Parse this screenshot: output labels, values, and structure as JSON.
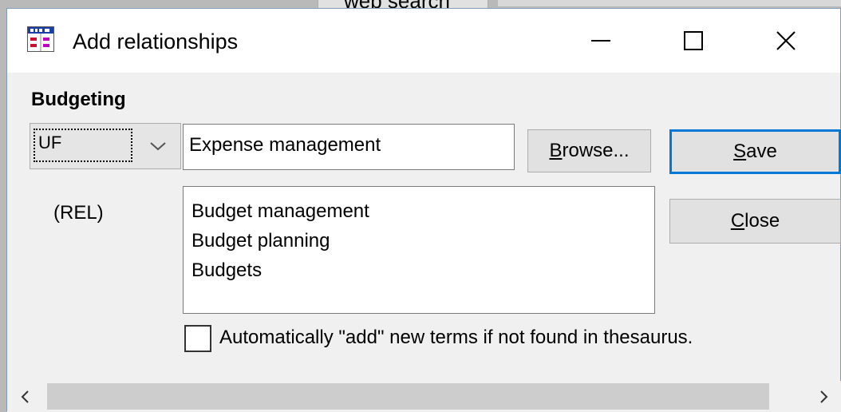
{
  "background": {
    "tab_label": "web search"
  },
  "window": {
    "title": "Add relationships",
    "icons": {
      "app": "thesaurus-app-icon",
      "minimize": "minimize-icon",
      "maximize": "maximize-icon",
      "close": "close-icon"
    }
  },
  "form": {
    "group_label": "Budgeting",
    "relationship_type": {
      "selected": "UF"
    },
    "term_input": {
      "value": "Expense management"
    },
    "browse_button": {
      "label_underline": "B",
      "label_rest": "rowse..."
    },
    "save_button": {
      "label_underline": "S",
      "label_rest": "ave"
    },
    "close_button": {
      "label_underline": "C",
      "label_rest": "lose"
    },
    "rel_label": "(REL)",
    "related_terms": [
      "Budget management",
      "Budget planning",
      "Budgets"
    ],
    "auto_add_checkbox": {
      "checked": false,
      "label": "Automatically \"add\" new terms if not found in thesaurus."
    }
  },
  "colors": {
    "focus_border": "#0078d7",
    "dialog_bg": "#f0f0f0",
    "titlebar_bg": "#ffffff"
  }
}
